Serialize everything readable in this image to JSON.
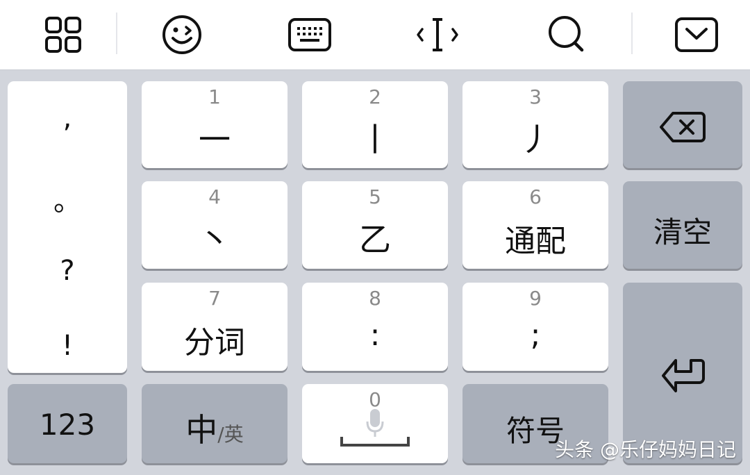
{
  "toolbar": {
    "items": [
      {
        "icon": "grid-icon"
      },
      {
        "icon": "emoji-icon"
      },
      {
        "icon": "keyboard-icon"
      },
      {
        "icon": "cursor-move-icon"
      },
      {
        "icon": "search-icon"
      },
      {
        "icon": "hide-keyboard-icon"
      }
    ]
  },
  "keyboard": {
    "punctuation": [
      ",",
      "。",
      "?",
      "!"
    ],
    "keys": {
      "k1": {
        "num": "1",
        "label": "一"
      },
      "k2": {
        "num": "2",
        "label": "丨"
      },
      "k3": {
        "num": "3",
        "label": "丿"
      },
      "k4": {
        "num": "4",
        "label": "丶"
      },
      "k5": {
        "num": "5",
        "label": "乙"
      },
      "k6": {
        "num": "6",
        "label": "通配"
      },
      "k7": {
        "num": "7",
        "label": "分词"
      },
      "k8": {
        "num": "8",
        "label": ":"
      },
      "k9": {
        "num": "9",
        "label": ";"
      },
      "k0": {
        "num": "0"
      }
    },
    "delete_icon": "backspace-icon",
    "clear_label": "清空",
    "enter_icon": "return-icon",
    "num_mode_label": "123",
    "lang_main": "中",
    "lang_sub": "/英",
    "symbol_label": "符号",
    "mic_icon": "microphone-icon",
    "space_icon": "space-icon"
  },
  "watermark": "头条 @乐仔妈妈日记",
  "colors": {
    "toolbar_bg": "#ffffff",
    "keyboard_bg": "#d2d5dc",
    "light_key": "#ffffff",
    "dark_key": "#a9afba",
    "text": "#111111",
    "number_hint": "#8a8a8a"
  }
}
